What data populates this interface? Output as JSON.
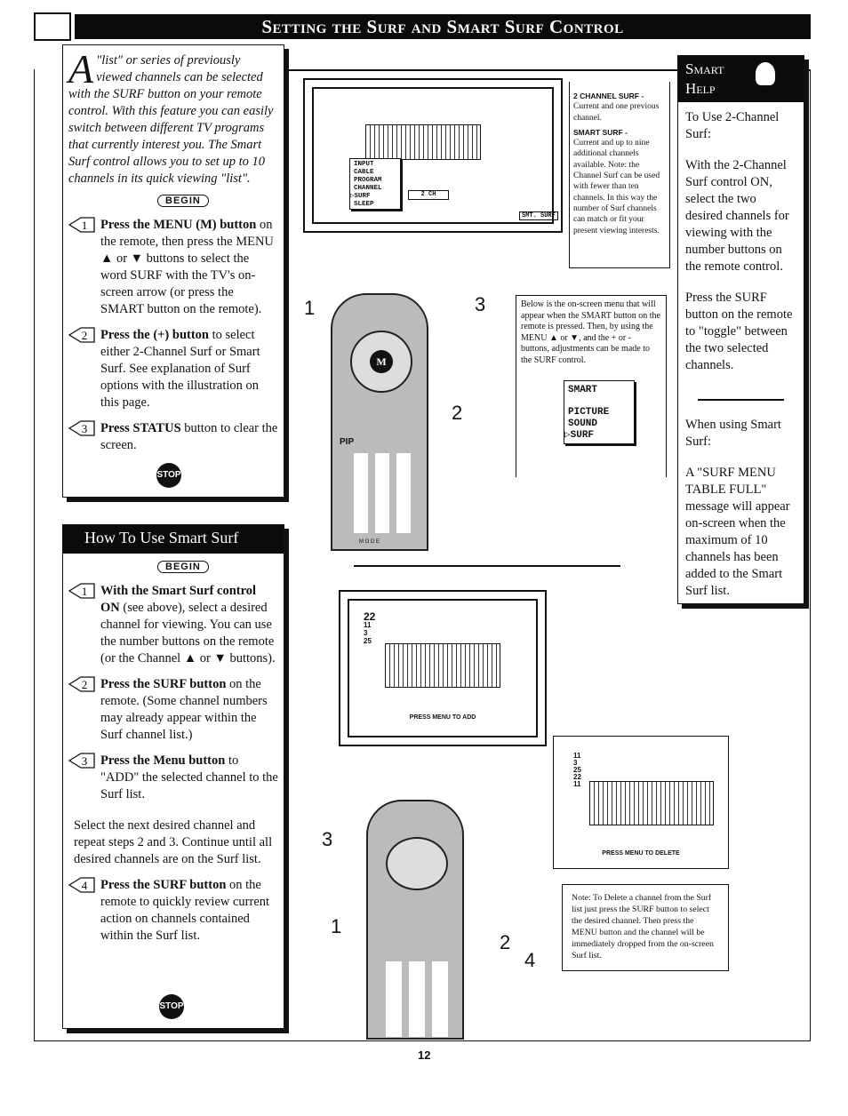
{
  "page_title": "Setting the Surf and Smart Surf Control",
  "intro": {
    "drop_cap": "A",
    "text": "\"list\" or series of previously viewed channels can be selected with the SURF button on your remote control. With this feature you can easily switch between different TV programs that currently interest you. The Smart Surf control allows you to set up to 10 channels in its quick viewing \"list\"."
  },
  "begin_label": "BEGIN",
  "stop_label": "STOP",
  "steps1": [
    {
      "n": "1",
      "bold": "Press the MENU (M) button",
      "text": " on the remote, then press the MENU ▲ or ▼ buttons to select the word SURF with the TV's on-screen arrow (or press the SMART button on the remote)."
    },
    {
      "n": "2",
      "bold": "Press the (+) button",
      "text": " to select either 2-Channel Surf or Smart Surf. See explanation of Surf options with the illustration on this page."
    },
    {
      "n": "3",
      "bold": "Press STATUS",
      "text": " button to clear the screen."
    }
  ],
  "section2": {
    "title": "How To Use Smart Surf",
    "steps": [
      {
        "n": "1",
        "bold": "With the Smart Surf control ON",
        "text": " (see above), select a desired channel for viewing. You can use the number buttons on the remote (or the Channel ▲ or ▼ buttons)."
      },
      {
        "n": "2",
        "bold": "Press the SURF button",
        "text": " on the remote. (Some channel numbers may already appear within the Surf channel list.)"
      },
      {
        "n": "3",
        "bold": "Press the Menu button",
        "text": " to \"ADD\" the selected channel to the Surf list."
      },
      {
        "n": "",
        "bold": "",
        "text": "Select the next desired channel and repeat steps 2 and 3. Continue until all desired channels are on the Surf list."
      },
      {
        "n": "4",
        "bold": "Press the SURF button",
        "text": " on the remote to quickly review current action on channels contained within the Surf list."
      }
    ]
  },
  "tv1": {
    "menu": [
      "INPUT",
      "CABLE",
      "PROGRAM",
      "CHANNEL",
      "SURF",
      "SLEEP"
    ],
    "selected": "SURF",
    "value": "2 CH",
    "tag": "SMT. SURF"
  },
  "surf_note": {
    "t1": "2 CHANNEL SURF -",
    "d1": "Current and one previous channel.",
    "t2": "SMART SURF -",
    "d2": "Current and up to nine additional channels available. Note: the Channel Surf can be used with fewer than ten channels. In this way the number of Surf channels can match or fit your present viewing interests."
  },
  "smart_note": {
    "text": "Below is the on-screen menu that will appear when the SMART button on the remote is pressed. Then, by using the MENU ▲ or ▼, and the + or - buttons, adjustments can be made to the SURF control.",
    "menu": [
      "SMART",
      "PICTURE",
      "SOUND",
      "SURF"
    ],
    "selected": "SURF"
  },
  "remote_labels": {
    "pip": "PIP",
    "mode": "M O D E"
  },
  "callouts": [
    "1",
    "2",
    "3"
  ],
  "callouts2": [
    "3",
    "1",
    "2",
    "4"
  ],
  "tv2": {
    "channels": [
      "22",
      "11",
      "3",
      "25"
    ],
    "message": "PRESS MENU TO ADD"
  },
  "tv3": {
    "channels": [
      "11",
      "3",
      "25",
      "22",
      "11"
    ],
    "message": "PRESS MENU TO DELETE"
  },
  "delete_note": "Note: To Delete a channel from the Surf list just press the SURF button to select the desired channel. Then press the MENU button and the channel will be immediately dropped from the on-screen Surf list.",
  "smart_help": {
    "title1": "Smart",
    "title2": "Help",
    "p1": "To Use 2-Channel Surf:",
    "p2": "With the 2-Channel Surf control ON, select the two desired channels for viewing with the number buttons on the remote control.",
    "p3": "Press the SURF button on the remote to \"toggle\" between the two selected channels.",
    "p4": "When using Smart Surf:",
    "p5": "A \"SURF MENU TABLE FULL\" message will appear on-screen when the maximum of 10 channels has been added to the Smart Surf list."
  },
  "page_number": "12"
}
